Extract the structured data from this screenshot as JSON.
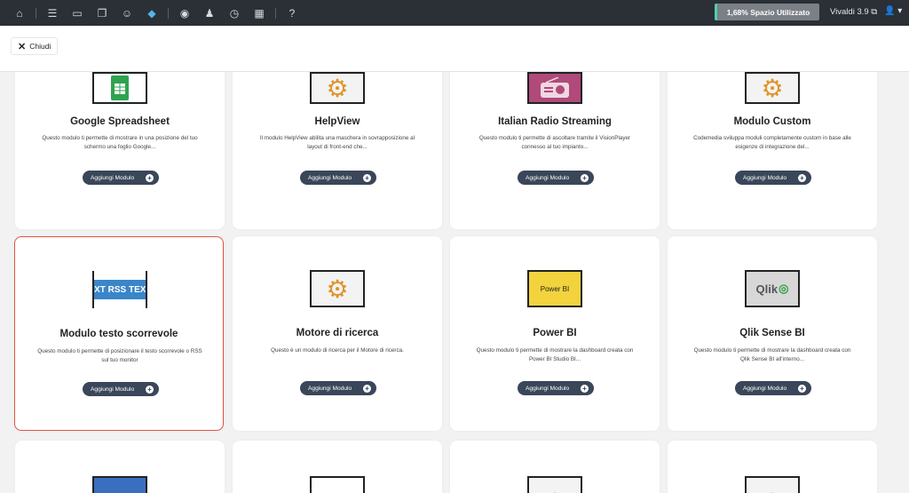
{
  "topbar": {
    "usage": "1,68% Spazio Utilizzato",
    "version": "Vivaldi 3.9 ⧉",
    "user": "👤 ▾"
  },
  "subbar": {
    "close_label": "Chiudi"
  },
  "cards": [
    {
      "title": "Google Spreadsheet",
      "desc": "Questo modulo ti permette di mostrare in una posizione del tuo schermo una foglio Google...",
      "button": "Aggiungi Modulo"
    },
    {
      "title": "HelpView",
      "desc": "Il modulo HelpView abilita una maschera in sovrapposizione al layout di front-end che...",
      "button": "Aggiungi Modulo"
    },
    {
      "title": "Italian Radio Streaming",
      "desc": "Questo modulo ti permette di ascoltare tramite il VisionPlayer connesso al tuo impianto...",
      "button": "Aggiungi Modulo"
    },
    {
      "title": "Modulo Custom",
      "desc": "Codemedia sviluppa moduli completamente custom in base alle esigenze di integrazione del...",
      "button": "Aggiungi Modulo"
    },
    {
      "title": "Modulo testo scorrevole",
      "desc": "Questo modulo ti permette di posizionare il testo scorrevole o RSS sul tuo monitor",
      "button": "Aggiungi Modulo",
      "thumb_text": "EXT RSS TEXT"
    },
    {
      "title": "Motore di ricerca",
      "desc": "Questo è un modulo di ricerca per il Motore di ricerca.",
      "button": "Aggiungi Modulo"
    },
    {
      "title": "Power BI",
      "desc": "Questo modulo ti permette di mostrare la dashboard creata con Power BI Studio BI...",
      "button": "Aggiungi Modulo",
      "thumb_text": "Power BI"
    },
    {
      "title": "Qlik Sense BI",
      "desc": "Questo modulo ti permette di mostrare la dashboard creata con Qlik Sense BI all'interno...",
      "button": "Aggiungi Modulo",
      "thumb_text": "Qlik"
    }
  ],
  "colors": {
    "accent_dark": "#3a4659",
    "selected_border": "#e2533f",
    "usage_bar": "#4dd0b0"
  }
}
